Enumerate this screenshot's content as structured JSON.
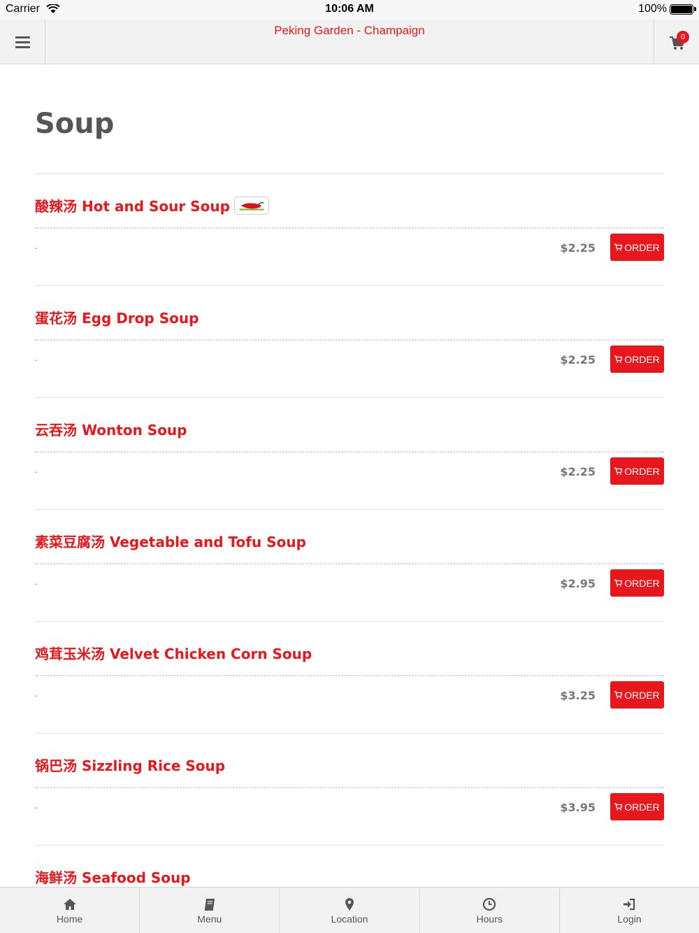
{
  "status_bar": {
    "carrier": "Carrier",
    "time": "10:06 AM",
    "battery": "100%"
  },
  "header": {
    "title": "Peking Garden - Champaign",
    "cart_count": "0"
  },
  "page": {
    "title": "Soup"
  },
  "menu_items": [
    {
      "name": "酸辣汤 Hot and Sour Soup",
      "description": ".",
      "price": "$2.25",
      "order_label": "ORDER",
      "spicy": true
    },
    {
      "name": "蛋花汤 Egg Drop Soup",
      "description": ".",
      "price": "$2.25",
      "order_label": "ORDER",
      "spicy": false
    },
    {
      "name": "云吞汤 Wonton Soup",
      "description": ".",
      "price": "$2.25",
      "order_label": "ORDER",
      "spicy": false
    },
    {
      "name": "素菜豆腐汤 Vegetable and Tofu Soup",
      "description": ".",
      "price": "$2.95",
      "order_label": "ORDER",
      "spicy": false
    },
    {
      "name": "鸡茸玉米汤 Velvet Chicken Corn Soup",
      "description": ".",
      "price": "$3.25",
      "order_label": "ORDER",
      "spicy": false
    },
    {
      "name": "锅巴汤 Sizzling Rice Soup",
      "description": ".",
      "price": "$3.95",
      "order_label": "ORDER",
      "spicy": false
    },
    {
      "name": "海鲜汤 Seafood Soup",
      "description": "",
      "price": "",
      "order_label": "",
      "spicy": false
    }
  ],
  "tab_bar": {
    "tabs": [
      {
        "label": "Home",
        "icon": "home-icon"
      },
      {
        "label": "Menu",
        "icon": "book-icon"
      },
      {
        "label": "Location",
        "icon": "map-pin-icon"
      },
      {
        "label": "Hours",
        "icon": "clock-icon"
      },
      {
        "label": "Login",
        "icon": "sign-in-icon"
      }
    ]
  },
  "colors": {
    "accent": "#e8171b",
    "header_bg": "#f2f2f2",
    "title_text": "#555555"
  }
}
